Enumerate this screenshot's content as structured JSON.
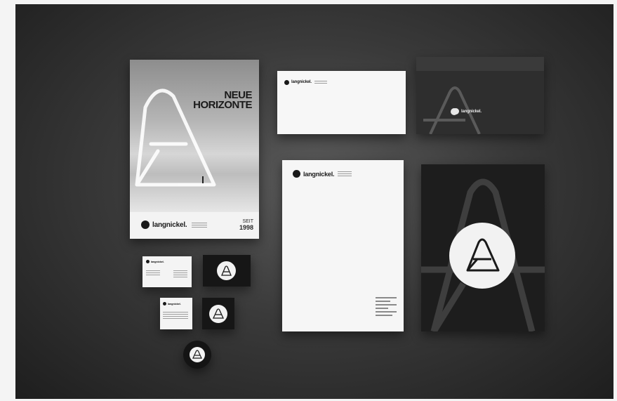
{
  "brand": {
    "wordmark": "langnickel.",
    "logo_description": "white rounded-A monogram"
  },
  "poster": {
    "headline_line1": "NEUE",
    "headline_line2": "HORIZONTE",
    "since_label": "SEIT",
    "since_year": "1998"
  },
  "colors": {
    "background_outer": "#f4f4f4",
    "scene_dark": "#1e1e1e",
    "paper_white": "#f6f6f6",
    "ink_black": "#1a1a1a"
  }
}
